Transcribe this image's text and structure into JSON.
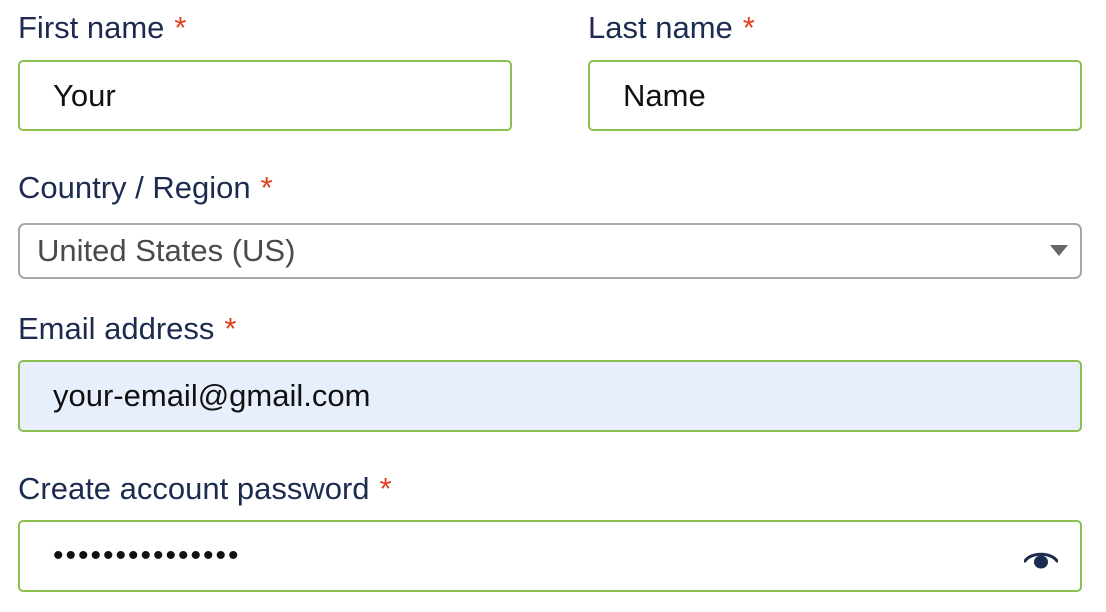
{
  "form": {
    "first_name": {
      "label": "First name",
      "required_mark": "*",
      "value": "Your"
    },
    "last_name": {
      "label": "Last name",
      "required_mark": "*",
      "value": "Name"
    },
    "country": {
      "label": "Country / Region",
      "required_mark": "*",
      "selected": "United States (US)"
    },
    "email": {
      "label": "Email address",
      "required_mark": "*",
      "value": "your-email@gmail.com"
    },
    "password": {
      "label": "Create account password",
      "required_mark": "*",
      "masked_value": "•••••••••••••••",
      "toggle_icon": "eye-icon"
    }
  },
  "colors": {
    "label": "#1c2b4f",
    "required": "#e2401c",
    "valid_border": "#8cc152",
    "select_border": "#a7a7a7",
    "autofill_bg": "#e8effc"
  }
}
